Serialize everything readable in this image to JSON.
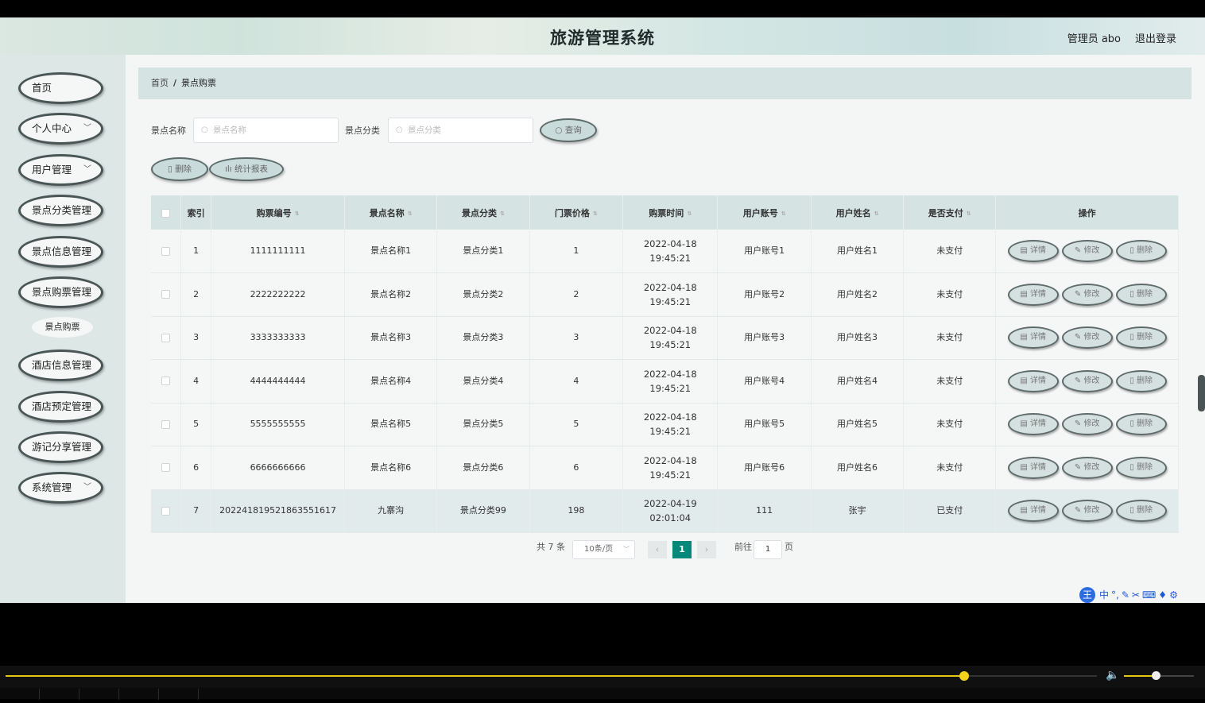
{
  "header": {
    "title": "旅游管理系统",
    "admin": "管理员 abo",
    "logout": "退出登录"
  },
  "sidebar": {
    "items": [
      {
        "label": "首页",
        "chevron": ""
      },
      {
        "label": "个人中心",
        "chevron": "﹀"
      },
      {
        "label": "用户管理",
        "chevron": "﹀"
      },
      {
        "label": "景点分类管理",
        "chevron": ""
      },
      {
        "label": "景点信息管理",
        "chevron": ""
      },
      {
        "label": "景点购票管理",
        "chevron": ""
      },
      {
        "label": "酒店信息管理",
        "chevron": ""
      },
      {
        "label": "酒店预定管理",
        "chevron": ""
      },
      {
        "label": "游记分享管理",
        "chevron": ""
      },
      {
        "label": "系统管理",
        "chevron": "﹀"
      }
    ],
    "subitem": "景点购票"
  },
  "breadcrumb": {
    "home": "首页",
    "sep": "/",
    "current": "景点购票"
  },
  "search": {
    "name_label": "景点名称",
    "name_placeholder": "景点名称",
    "cat_label": "景点分类",
    "cat_placeholder": "景点分类",
    "query_button": "查询"
  },
  "toolbar": {
    "delete_button": "删除",
    "report_button": "统计报表"
  },
  "table": {
    "headers": [
      "索引",
      "购票编号",
      "景点名称",
      "景点分类",
      "门票价格",
      "购票时间",
      "用户账号",
      "用户姓名",
      "是否支付",
      "操作"
    ],
    "actions": {
      "detail": "详情",
      "edit": "修改",
      "delete": "删除"
    },
    "rows": [
      {
        "idx": "1",
        "no": "1111111111",
        "name": "景点名称1",
        "cat": "景点分类1",
        "price": "1",
        "time": "2022-04-18 19:45:21",
        "account": "用户账号1",
        "user": "用户姓名1",
        "paid": "未支付"
      },
      {
        "idx": "2",
        "no": "2222222222",
        "name": "景点名称2",
        "cat": "景点分类2",
        "price": "2",
        "time": "2022-04-18 19:45:21",
        "account": "用户账号2",
        "user": "用户姓名2",
        "paid": "未支付"
      },
      {
        "idx": "3",
        "no": "3333333333",
        "name": "景点名称3",
        "cat": "景点分类3",
        "price": "3",
        "time": "2022-04-18 19:45:21",
        "account": "用户账号3",
        "user": "用户姓名3",
        "paid": "未支付"
      },
      {
        "idx": "4",
        "no": "4444444444",
        "name": "景点名称4",
        "cat": "景点分类4",
        "price": "4",
        "time": "2022-04-18 19:45:21",
        "account": "用户账号4",
        "user": "用户姓名4",
        "paid": "未支付"
      },
      {
        "idx": "5",
        "no": "5555555555",
        "name": "景点名称5",
        "cat": "景点分类5",
        "price": "5",
        "time": "2022-04-18 19:45:21",
        "account": "用户账号5",
        "user": "用户姓名5",
        "paid": "未支付"
      },
      {
        "idx": "6",
        "no": "6666666666",
        "name": "景点名称6",
        "cat": "景点分类6",
        "price": "6",
        "time": "2022-04-18 19:45:21",
        "account": "用户账号6",
        "user": "用户姓名6",
        "paid": "未支付"
      },
      {
        "idx": "7",
        "no": "202241819521863551617",
        "name": "九寨沟",
        "cat": "景点分类99",
        "price": "198",
        "time": "2022-04-19 02:01:04",
        "account": "111",
        "user": "张宇",
        "paid": "已支付"
      }
    ]
  },
  "pagination": {
    "total": "共 7 条",
    "page_size": "10条/页",
    "prev": "‹",
    "next": "›",
    "current_page": "1",
    "goto_label": "前往",
    "goto_value": "1",
    "page_suffix": "页"
  },
  "ime": {
    "logo": "王",
    "mode": "中"
  },
  "player": {
    "progress": 0.8785,
    "volume": 0.45
  }
}
